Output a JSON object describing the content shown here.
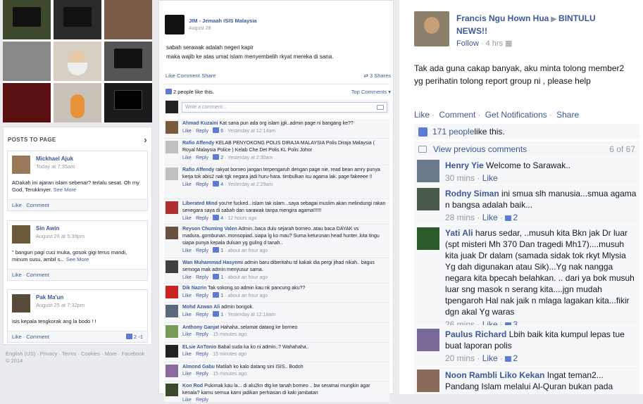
{
  "left": {
    "posts_title": "POSTS TO PAGE",
    "posts": [
      {
        "name": "Mickhael Ajuk",
        "time": "Today at 7:35am",
        "text": "ADakah ini ajaran islam sebenar? terlalu sesat. Oh my God, Terukknyer.",
        "see_more": "See More",
        "actions": [
          "Like",
          "Comment"
        ]
      },
      {
        "name": "Sin Awin",
        "time": "August 26 at 5:39pm",
        "text": "\" bangun pagi cuci muka, gosok gigi terus mandi, minum susu, ambil s...",
        "see_more": "See More",
        "actions": [
          "Like",
          "Comment"
        ]
      },
      {
        "name": "Pak Ma'un",
        "time": "August 25 at 7:32pm",
        "text": "isis kepala tengkorak ang la bodo ! !",
        "actions": [
          "Like",
          "Comment"
        ],
        "likes": "2",
        "comments": "1"
      }
    ],
    "footer": "English (US) · Privacy · Terms · Cookies · More · Facebook © 2014"
  },
  "group": {
    "author": "JIM - Jemaah ISIS Malaysia",
    "date": "August 28",
    "text_line1": "sabah serawak adalah negeri kapir",
    "text_line2": "maka wajib ke atas umat islam menyembelih rkyat mereka di sana.",
    "actions": [
      "Like",
      "Comment",
      "Share"
    ],
    "shares": "3 Shares",
    "likes": "2 people like this.",
    "top_comments": "Top Comments ▾",
    "comment_placeholder": "Write a comment...",
    "comments": [
      {
        "name": "Ahmad Kuzaini",
        "text": "Kat sana pun ada org islam jgk..admin page ni bangang ke??",
        "likes": "6",
        "time": "Yesterday at 12:14am"
      },
      {
        "name": "Rafio Affendy",
        "text": "KELAB PENYOKONG POLIS DIRAJA MALAYSIA Polis Diraja Malaysia ( Royal Malaysia Police ) Kelab Che Det Polis KL Polis Johor",
        "likes": "2",
        "time": "Yesterday at 2:30am"
      },
      {
        "name": "Rafio Affendy",
        "text": "rakyat borneo jangan terpengaruh dengan page nie. read bean amry punya kerja tok abis2 nak tgk negara jadi huru-hara. timbulkan isu agama lak. page fakeeee !!",
        "likes": "4",
        "time": "Yesterday at 2:29am"
      },
      {
        "name": "Liberated Mind",
        "text": "you're fucked...islam tak islam...saya sebagai muslim akan melindungi rakan senegara saya di sabah dan sarawak tanpa mengira agama!!!!!!",
        "likes": "4",
        "time": "12 hours ago"
      },
      {
        "name": "Reyson Chuming Valen",
        "text": "Admin..baca dulu sejarah borneo..atau baca DAYAK vs madura..gombunan..monsopiad..siapa lg ko mau? Suma keturunan head hunter..kita tingu siapa punya kepala duluan yg guling d tanah..",
        "likes": "1",
        "time": "about an hour ago"
      },
      {
        "name": "Wan Muhammad Hasyemi",
        "text": "admin baru diberitahu td kakak dia pergi jihad nikah.. bagus semoga mak admin menyusur sama.",
        "likes": "1",
        "time": "about an hour ago"
      },
      {
        "name": "Dik Nazrin",
        "text": "Tak sokong.so admin kau nk pancung aku??",
        "likes": "1",
        "time": "about an hour ago"
      },
      {
        "name": "Mohd Azwan Ali",
        "text": "admin bongok.",
        "likes": "1",
        "time": "Yesterday at 12:18am"
      },
      {
        "name": "Anthony Ganjat",
        "text": "Hahaha..selamat datang ke borneo",
        "likes": "",
        "time": "15 minutes ago"
      },
      {
        "name": "ELsie AnTonio",
        "text": "Babal suda ka ko ni admin..? Wahahaha..",
        "likes": "",
        "time": "15 minutes ago"
      },
      {
        "name": "Almond Gabu",
        "text": "Matilah ko kalo datang sini ISIS.. Bodoh",
        "likes": "",
        "time": "15 minutes ago"
      },
      {
        "name": "Kon Rod",
        "text": "Pukimak kau la... di alu2kn dtg ke tanah borneo .. bw seramai mungkin agar kenala? kamu semua kami jadikan perhiasan di kaki jambatan",
        "likes": "",
        "time": ""
      }
    ]
  },
  "fb": {
    "author": "Francis Ngu Hown Hua",
    "target": "BINTULU NEWS!!",
    "follow": "Follow",
    "time": "4 hrs",
    "text": "Tak ada guna cakap banyak, aku minta tolong member2 yg perihatin tolong report group ni , please help",
    "actions": [
      "Like",
      "Comment",
      "Get Notifications",
      "Share"
    ],
    "likes_link": "171 people",
    "likes_suffix": " like this.",
    "view_prev": "View previous comments",
    "count": "6 of 67",
    "comments": [
      {
        "name": "Henry Yie",
        "text": "Welcome to Sarawak..",
        "time": "30 mins",
        "likes": ""
      },
      {
        "name": "Rodny Siman",
        "text": "ini smua slh manusia...smua agama n bangsa adalah baik...",
        "time": "28 mins",
        "likes": "2"
      },
      {
        "name": "Yati Ali",
        "text": "harus sedar, ..musuh kita Bkn jak Dr luar (spt misteri Mh 370 Dan tragedi Mh17)....musuh kita juak Dr dalam (samada sidak tok rkyt Mlysia Yg dah digunakan atau Sik)...Yg nak nangga negara kita bpecah belahkan. .. dari ya bok musuh luar sng masok n serang kita....jgn mudah tpengaroh Hal nak jaik n mlaga lagakan kita...fikir dgn akal Yg waras",
        "time": "26 mins",
        "likes": "3"
      },
      {
        "name": "Paulus Richard",
        "text": "Lbih baik kita kumpul lepas tue buat laporan polis",
        "time": "20 mins",
        "likes": "2"
      },
      {
        "name": "Noon Rambli Liko Kekan",
        "text": "Ingat teman2... Pandang Islam melalui Al-Quran bukan pada",
        "time": "",
        "likes": ""
      }
    ]
  }
}
